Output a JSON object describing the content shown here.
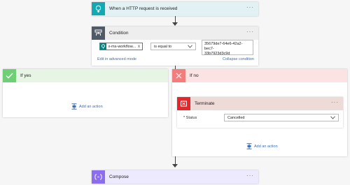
{
  "trigger": {
    "title": "When a HTTP request is received",
    "more": "···",
    "color": "#12a8b4"
  },
  "condition": {
    "title": "Condition",
    "more": "···",
    "color": "#505a66",
    "token_label": "x-ms-workflow...",
    "token_remove": "x",
    "operator": "is equal to",
    "value_line1": "35679de7-64e6-42a2-bec7-",
    "value_line2": "33b7923d3c9d",
    "add_advanced": "Edit in advanced mode",
    "collapse": "Collapse condition"
  },
  "branch_yes": {
    "title": "If yes",
    "color": "#6fcf74",
    "add_action": "Add an action"
  },
  "branch_no": {
    "title": "If no",
    "color": "#f27d7d",
    "add_action": "Add an action",
    "terminate": {
      "title": "Terminate",
      "more": "···",
      "color": "#e8262a",
      "status_label": "* Status",
      "status_value": "Cancelled"
    }
  },
  "compose": {
    "title": "Compose",
    "more": "···",
    "color": "#8c6cf0"
  }
}
